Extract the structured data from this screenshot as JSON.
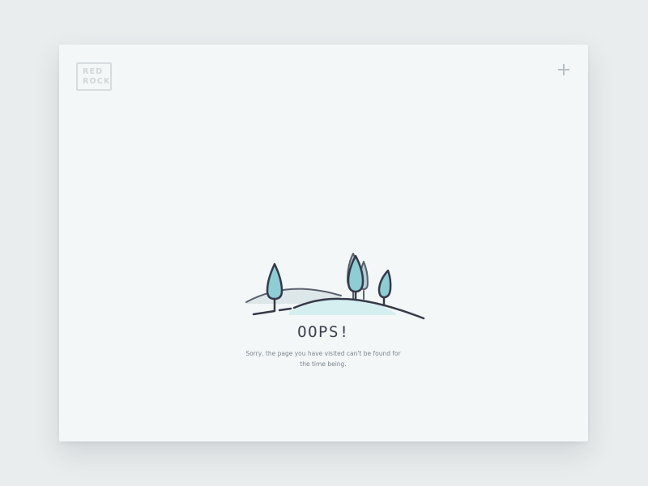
{
  "logo": {
    "line1": "RED",
    "line2": "ROCK"
  },
  "header": {
    "action_icon": "plus-icon"
  },
  "error": {
    "title": "OOPS!",
    "message": "Sorry, the page you have visited can't be found for the time being."
  },
  "illustration": {
    "icon": "hills-trees-illustration"
  },
  "colors": {
    "background": "#eaedee",
    "card": "#f3f7f8",
    "outline": "#363a4a",
    "tree_fill": "#8ecdd3",
    "tree_fill_light": "#b4d8db",
    "hill_fill": "#dbf0f1",
    "logo": "#d2d7da"
  }
}
